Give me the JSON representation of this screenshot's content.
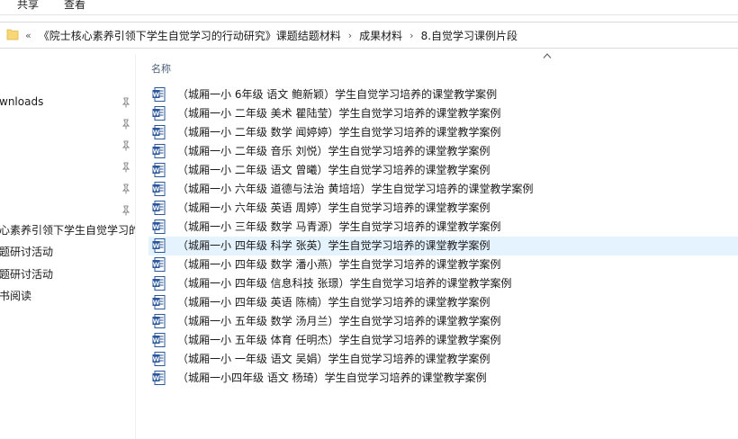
{
  "ribbon": {
    "tabs": [
      "共享",
      "查看"
    ]
  },
  "address": {
    "more_label": "«",
    "crumbs": [
      "《院士核心素养引领下学生自觉学习的行动研究》课题结题材料",
      "成果材料",
      "8.自觉学习课例片段"
    ]
  },
  "nav": {
    "pinned": [
      "wnloads",
      "",
      "",
      "",
      "",
      ""
    ],
    "folders": [
      "心素养引领下学生自觉学习的",
      "题研讨活动",
      "题研讨活动",
      "书阅读"
    ]
  },
  "list": {
    "column_name": "名称",
    "files": [
      "（城厢一小 6年级 语文 鲍新颖）学生自觉学习培养的课堂教学案例",
      "（城厢一小 二年级 美术 瞿陆莹）学生自觉学习培养的课堂教学案例",
      "（城厢一小 二年级 数学 闻婷婷）学生自觉学习培养的课堂教学案例",
      "（城厢一小 二年级 音乐 刘悦）学生自觉学习培养的课堂教学案例",
      "（城厢一小 二年级 语文 曾曦）学生自觉学习培养的课堂教学案例",
      "（城厢一小 六年级 道德与法治 黄培培）学生自觉学习培养的课堂教学案例",
      "（城厢一小 六年级 英语 周婷）学生自觉学习培养的课堂教学案例",
      "（城厢一小 三年级 数学 马青源）学生自觉学习培养的课堂教学案例",
      "（城厢一小 四年级 科学 张英）学生自觉学习培养的课堂教学案例",
      "（城厢一小 四年级 数学 潘小燕）学生自觉学习培养的课堂教学案例",
      "（城厢一小 四年级 信息科技 张璟）学生自觉学习培养的课堂教学案例",
      "（城厢一小 四年级 英语 陈楠）学生自觉学习培养的课堂教学案例",
      "（城厢一小 五年级 数学 汤月兰）学生自觉学习培养的课堂教学案例",
      "（城厢一小 五年级 体育 任明杰）学生自觉学习培养的课堂教学案例",
      "（城厢一小 一年级 语文 吴娟）学生自觉学习培养的课堂教学案例",
      "（城厢一小四年级 语文 杨琦）学生自觉学习培养的课堂教学案例"
    ],
    "selected_index": 8,
    "file_icon": "word-document-icon"
  },
  "colors": {
    "selection": "#e5f3ff",
    "word_blue": "#2b579a",
    "folder_yellow": "#f8d775"
  }
}
